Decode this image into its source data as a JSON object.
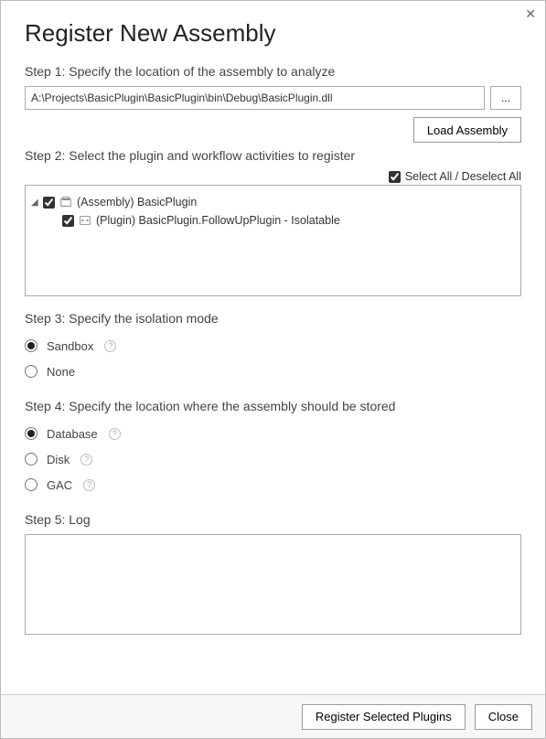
{
  "title": "Register New Assembly",
  "close_x": "✕",
  "step1": {
    "label": "Step 1: Specify the location of the assembly to analyze",
    "path": "A:\\Projects\\BasicPlugin\\BasicPlugin\\bin\\Debug\\BasicPlugin.dll",
    "browse": "...",
    "load": "Load Assembly"
  },
  "step2": {
    "label": "Step 2: Select the plugin and workflow activities to register",
    "select_all": "Select All / Deselect All",
    "select_all_checked": true,
    "tree": {
      "assembly": {
        "checked": true,
        "label": "(Assembly) BasicPlugin"
      },
      "plugin": {
        "checked": true,
        "label": "(Plugin) BasicPlugin.FollowUpPlugin - Isolatable"
      }
    }
  },
  "step3": {
    "label": "Step 3: Specify the isolation mode",
    "options": {
      "sandbox": "Sandbox",
      "none": "None"
    },
    "selected": "sandbox"
  },
  "step4": {
    "label": "Step 4: Specify the location where the assembly should be stored",
    "options": {
      "database": "Database",
      "disk": "Disk",
      "gac": "GAC"
    },
    "selected": "database"
  },
  "step5": {
    "label": "Step 5: Log"
  },
  "footer": {
    "register": "Register Selected Plugins",
    "close": "Close"
  },
  "help_glyph": "?"
}
